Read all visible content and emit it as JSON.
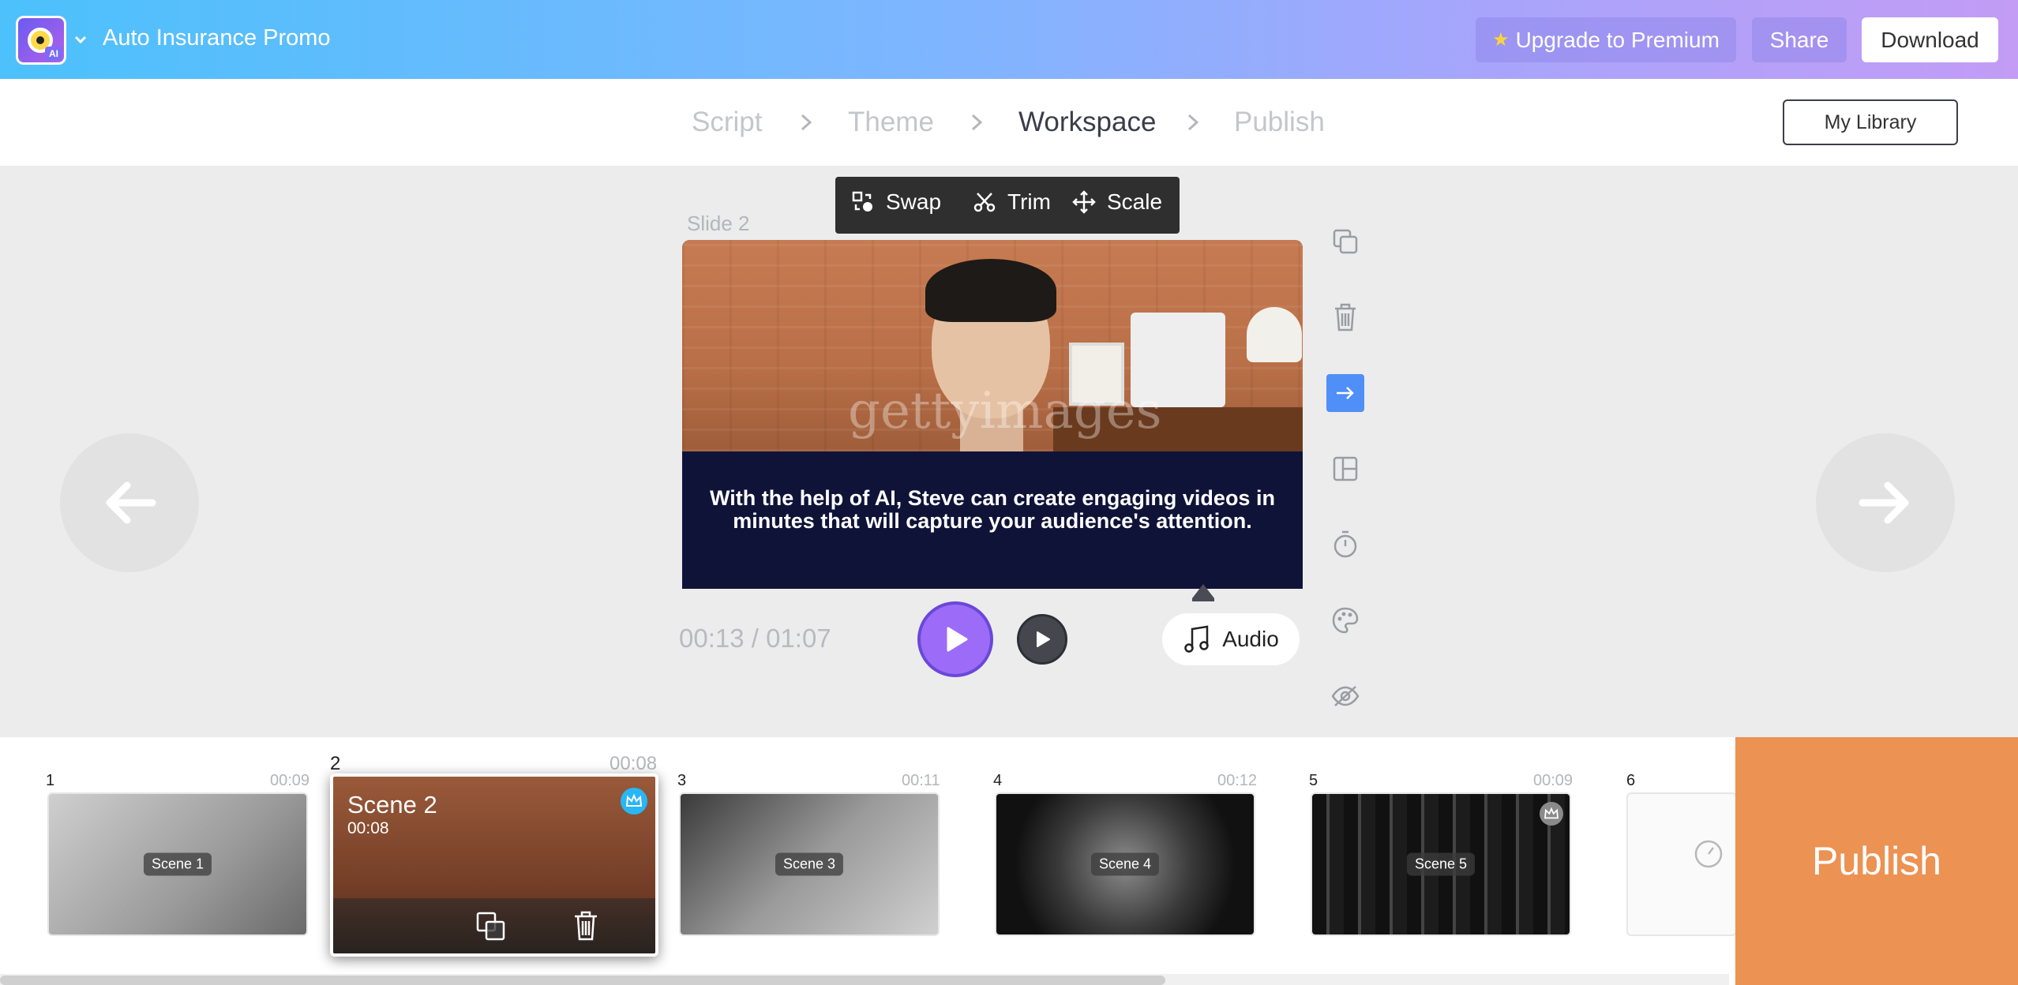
{
  "header": {
    "project_title": "Auto Insurance Promo",
    "logo_badge": "AI",
    "upgrade_label": "Upgrade to Premium",
    "share_label": "Share",
    "download_label": "Download"
  },
  "steps": [
    {
      "label": "Script",
      "active": false
    },
    {
      "label": "Theme",
      "active": false
    },
    {
      "label": "Workspace",
      "active": true
    },
    {
      "label": "Publish",
      "active": false
    }
  ],
  "library_label": "My Library",
  "toolbar": {
    "swap": "Swap",
    "trim": "Trim",
    "scale": "Scale"
  },
  "slide": {
    "label": "Slide 2",
    "watermark": "gettyimages",
    "caption": "With the help of AI, Steve can create engaging videos in minutes that will capture your audience's attention."
  },
  "player": {
    "time": "00:13 / 01:07",
    "audio_label": "Audio"
  },
  "right_tools": [
    "duplicate-icon",
    "trash-icon",
    "transition-icon",
    "layout-icon",
    "timer-icon",
    "palette-icon",
    "hide-icon"
  ],
  "scenes": [
    {
      "number": "1",
      "duration": "00:09",
      "label": "Scene 1"
    },
    {
      "number": "2",
      "duration": "00:08",
      "label": "Scene 2",
      "active": true,
      "premium": true
    },
    {
      "number": "3",
      "duration": "00:11",
      "label": "Scene 3"
    },
    {
      "number": "4",
      "duration": "00:12",
      "label": "Scene 4"
    },
    {
      "number": "5",
      "duration": "00:09",
      "label": "Scene 5",
      "premium": true
    },
    {
      "number": "6",
      "duration": "",
      "label": ""
    }
  ],
  "publish_label": "Publish",
  "colors": {
    "accent_purple": "#9c6cf8",
    "publish_orange": "#ec9253",
    "active_tool_blue": "#4f8ff7",
    "premium_blue": "#29b6f6"
  }
}
